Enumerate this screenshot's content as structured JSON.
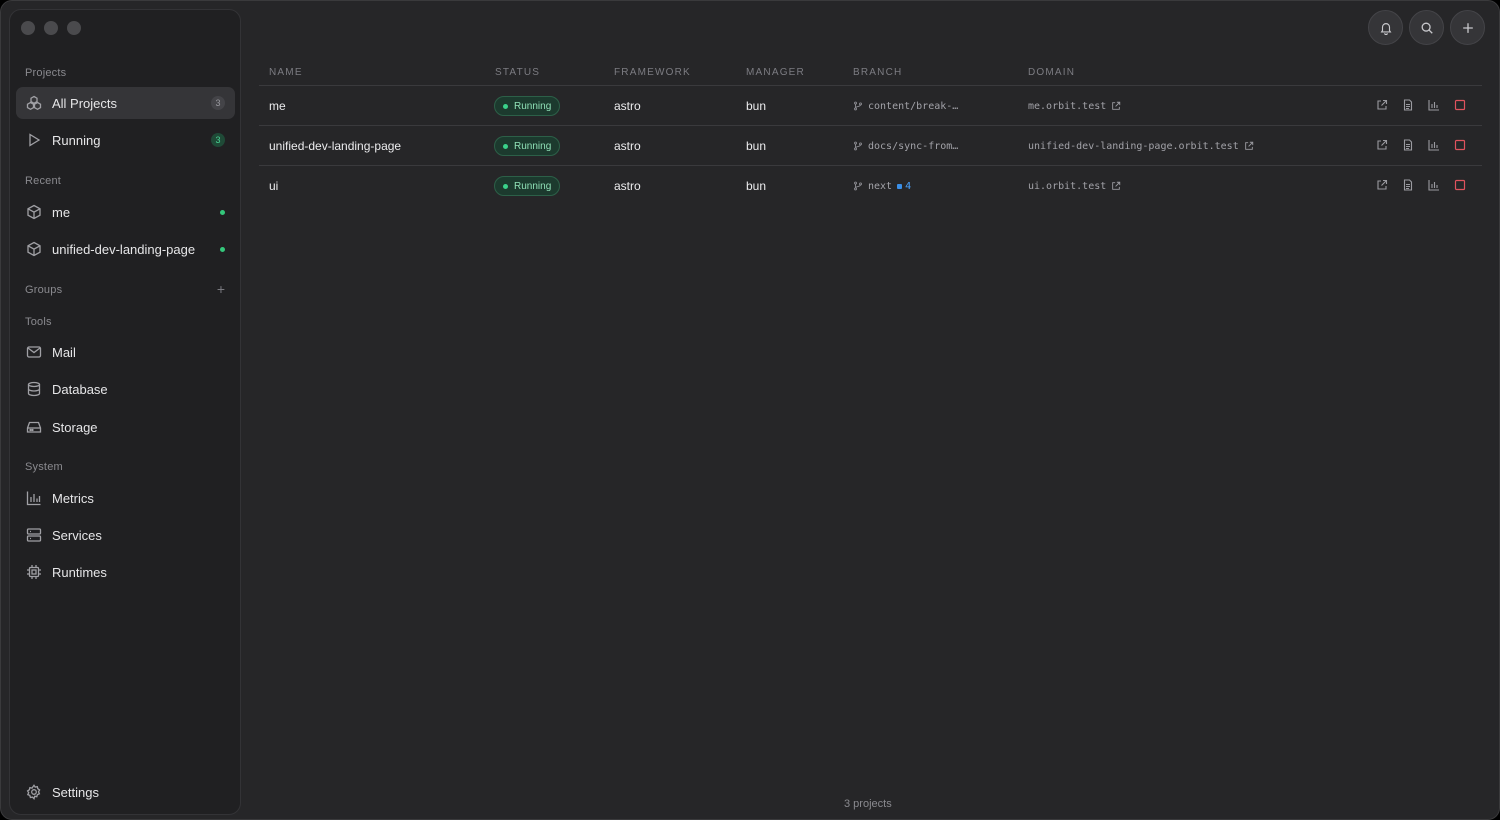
{
  "sidebar": {
    "sections": {
      "projects": "Projects",
      "recent": "Recent",
      "groups": "Groups",
      "tools": "Tools",
      "system": "System"
    },
    "projects": [
      {
        "label": "All Projects",
        "count": "3"
      },
      {
        "label": "Running",
        "count": "3"
      }
    ],
    "recent": [
      {
        "label": "me"
      },
      {
        "label": "unified-dev-landing-page"
      }
    ],
    "groups_add": "+",
    "tools": [
      {
        "label": "Mail",
        "icon": "mail-icon"
      },
      {
        "label": "Database",
        "icon": "database-icon"
      },
      {
        "label": "Storage",
        "icon": "storage-icon"
      }
    ],
    "system": [
      {
        "label": "Metrics",
        "icon": "metrics-icon"
      },
      {
        "label": "Services",
        "icon": "services-icon"
      },
      {
        "label": "Runtimes",
        "icon": "runtimes-icon"
      }
    ],
    "settings": "Settings"
  },
  "table": {
    "columns": [
      "NAME",
      "STATUS",
      "FRAMEWORK",
      "MANAGER",
      "BRANCH",
      "DOMAIN"
    ],
    "rows": [
      {
        "name": "me",
        "status": "Running",
        "framework": "astro",
        "manager": "bun",
        "branch": "content/break-…",
        "ahead": "",
        "domain": "me.orbit.test"
      },
      {
        "name": "unified-dev-landing-page",
        "status": "Running",
        "framework": "astro",
        "manager": "bun",
        "branch": "docs/sync-from…",
        "ahead": "",
        "domain": "unified-dev-landing-page.orbit.test"
      },
      {
        "name": "ui",
        "status": "Running",
        "framework": "astro",
        "manager": "bun",
        "branch": "next",
        "ahead": "4",
        "domain": "ui.orbit.test"
      }
    ]
  },
  "footer": "3 projects",
  "colors": {
    "accent_green": "#34c77b",
    "stop_red": "#e0535e",
    "ahead_blue": "#4aa3ff"
  }
}
